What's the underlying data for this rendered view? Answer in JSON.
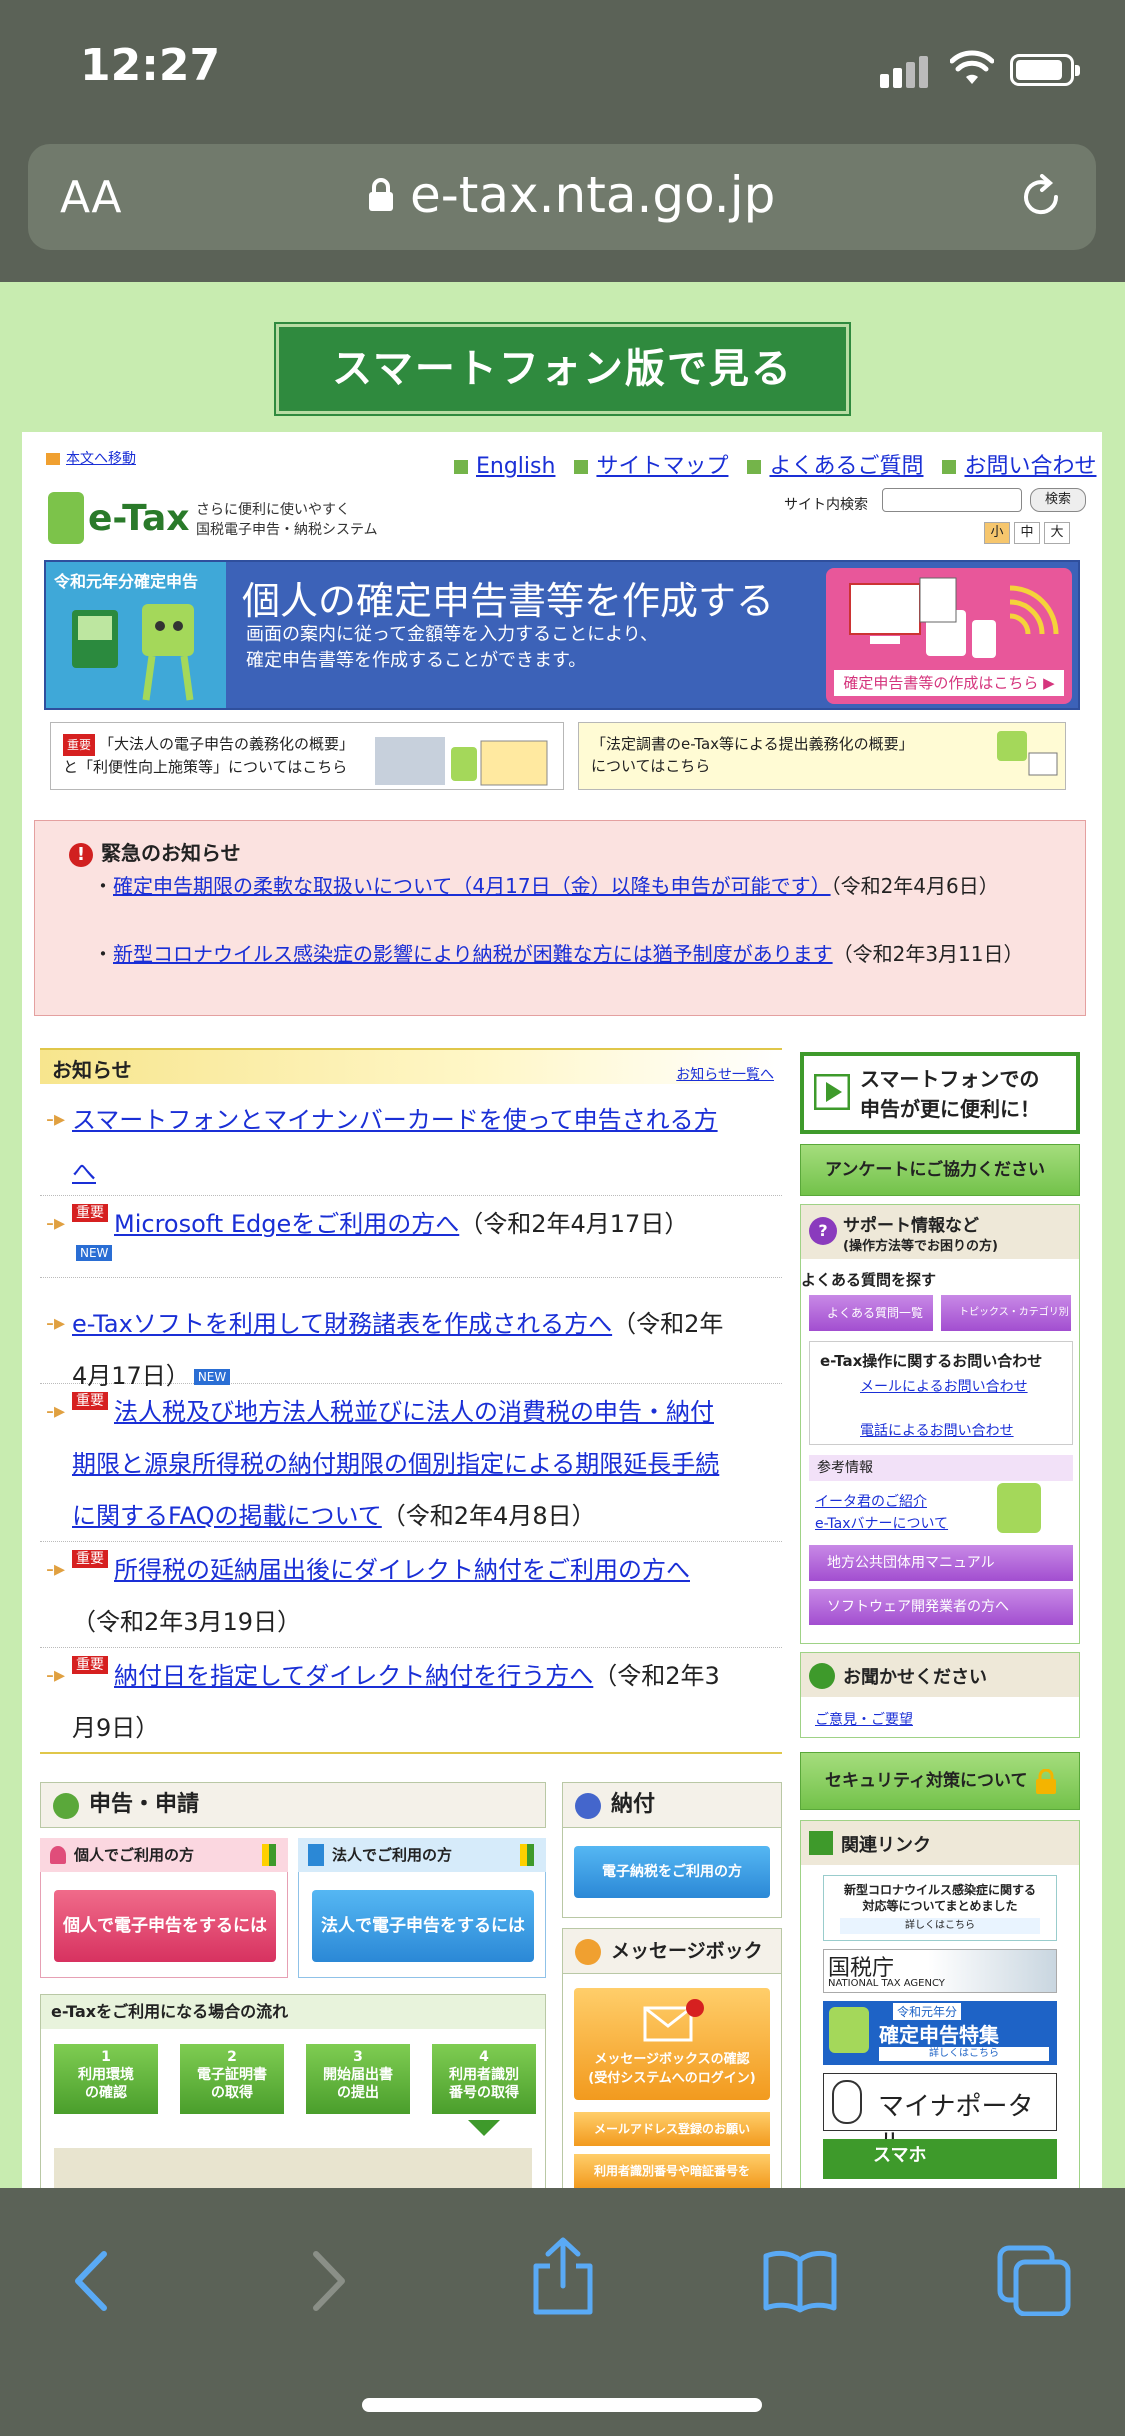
{
  "status": {
    "time": "12:27"
  },
  "browser": {
    "aa": "AA",
    "url": "e-tax.nta.go.jp"
  },
  "page": {
    "smartphone_button": "スマートフォン版で見る",
    "skip_link": "本文へ移動",
    "top_links": [
      "English",
      "サイトマップ",
      "よくあるご質問",
      "お問い合わせ"
    ],
    "logo": {
      "name": "e-Tax",
      "tagline1": "さらに便利に使いやすく",
      "tagline2": "国税電子申告・納税システム"
    },
    "search": {
      "label": "サイト内検索",
      "button": "検索"
    },
    "font_sizes": [
      "小",
      "中",
      "大"
    ],
    "banner": {
      "tag": "令和元年分確定申告",
      "title": "個人の確定申告書等を作成する",
      "desc1": "画面の案内に従って金額等を入力することにより、",
      "desc2": "確定申告書等を作成することができます。",
      "cta": "確定申告書等の作成はこちら ▶"
    },
    "sub_banners": [
      {
        "badge": "重要",
        "line1": "「大法人の電子申告の義務化の概要」",
        "line2": "と「利便性向上施策等」についてはこちら"
      },
      {
        "line1": "「法定調書のe-Tax等による提出義務化の概要」",
        "line2": "についてはこちら"
      }
    ],
    "urgent": {
      "title": "緊急のお知らせ",
      "items": [
        {
          "link": "確定申告期限の柔軟な取扱いについて（4月17日（金）以降も申告が可能です）",
          "date": "（令和2年4月6日）"
        },
        {
          "link": "新型コロナウイルス感染症の影響により納税が困難な方には猶予制度があります",
          "date": "（令和2年3月11日）"
        }
      ]
    },
    "news": {
      "label": "お知らせ",
      "more": "お知らせ一覧へ",
      "badge_important": "重要",
      "badge_new": "NEW",
      "items": [
        {
          "link1": "スマートフォンとマイナンバーカードを使って申告される方",
          "link2": "へ",
          "date": ""
        },
        {
          "link1": "Microsoft Edgeをご利用の方へ",
          "date": "（令和2年4月17日）"
        },
        {
          "link1": "e-Taxソフトを利用して財務諸表を作成される方へ",
          "date1": "（令和2年",
          "date2": "4月17日）"
        },
        {
          "link1": "法人税及び地方法人税並びに法人の消費税の申告・納付",
          "link2": "期限と源泉所得税の納付期限の個別指定による期限延長手続",
          "link3": "に関するFAQの掲載について",
          "date": "（令和2年4月8日）"
        },
        {
          "link1": "所得税の延納届出後にダイレクト納付をご利用の方へ",
          "date": "（令和2年3月19日）"
        },
        {
          "link1": "納付日を指定してダイレクト納付を行う方へ",
          "date1": "（令和2年3",
          "date2": "月9日）"
        }
      ]
    },
    "right": {
      "smartphone": {
        "line1": "スマートフォンでの",
        "line2": "申告が更に便利に！"
      },
      "survey": "アンケートにご協力ください",
      "support_title": "サポート情報など",
      "support_sub": "(操作方法等でお困りの方)",
      "faq_label": "よくある質問を探す",
      "faq_buttons": [
        "よくある質問一覧へ",
        "トピックス・カテゴリ別に調べる"
      ],
      "contact_title": "e-Tax操作に関するお問い合わせ",
      "contact_mail": "メールによるお問い合わせ",
      "contact_phone": "電話によるお問い合わせ",
      "ref_label": "参考情報",
      "ref_links": [
        "イータ君のご紹介",
        "e-Taxバナーについて"
      ],
      "purple_buttons": [
        "地方公共団体用マニュアル",
        "ソフトウェア開発業者の方へ"
      ],
      "voice_title": "お聞かせください",
      "voice_link": "ご意見・ご要望",
      "security": "セキュリティ対策について",
      "related_title": "関連リンク",
      "corona": {
        "line1": "新型コロナウイルス感染症に関する",
        "line2": "対応等についてまとめました",
        "btn": "詳しくはこちら"
      },
      "nta": {
        "name": "国税庁",
        "en": "NATIONAL TAX AGENCY"
      },
      "kakutei": {
        "tag": "令和元年分",
        "name": "確定申告特集",
        "btn": "詳しくはこちら"
      },
      "myna": "マイナポータル",
      "sumaho": "スマホ"
    },
    "filing": {
      "title": "申告・申請",
      "individual": "個人でご利用の方",
      "corporate": "法人でご利用の方",
      "individual_btn": "個人で電子申告をするには",
      "corporate_btn": "法人で電子申告をするには"
    },
    "payment": {
      "title": "納付",
      "btn": "電子納税をご利用の方"
    },
    "message_box": {
      "title": "メッセージボックス",
      "line1": "メッセージボックスの確認",
      "line2": "(受付システムへのログイン)",
      "btn1": "メールアドレス登録のお願い",
      "btn2": "利用者識別番号や暗証番号を"
    },
    "flow": {
      "title": "e-Taxをご利用になる場合の流れ",
      "steps": [
        {
          "num": "1",
          "l1": "利用環境",
          "l2": "の確認"
        },
        {
          "num": "2",
          "l1": "電子証明書",
          "l2": "の取得"
        },
        {
          "num": "3",
          "l1": "開始届出書",
          "l2": "の提出"
        },
        {
          "num": "4",
          "l1": "利用者識別",
          "l2": "番号の取得"
        }
      ]
    }
  }
}
